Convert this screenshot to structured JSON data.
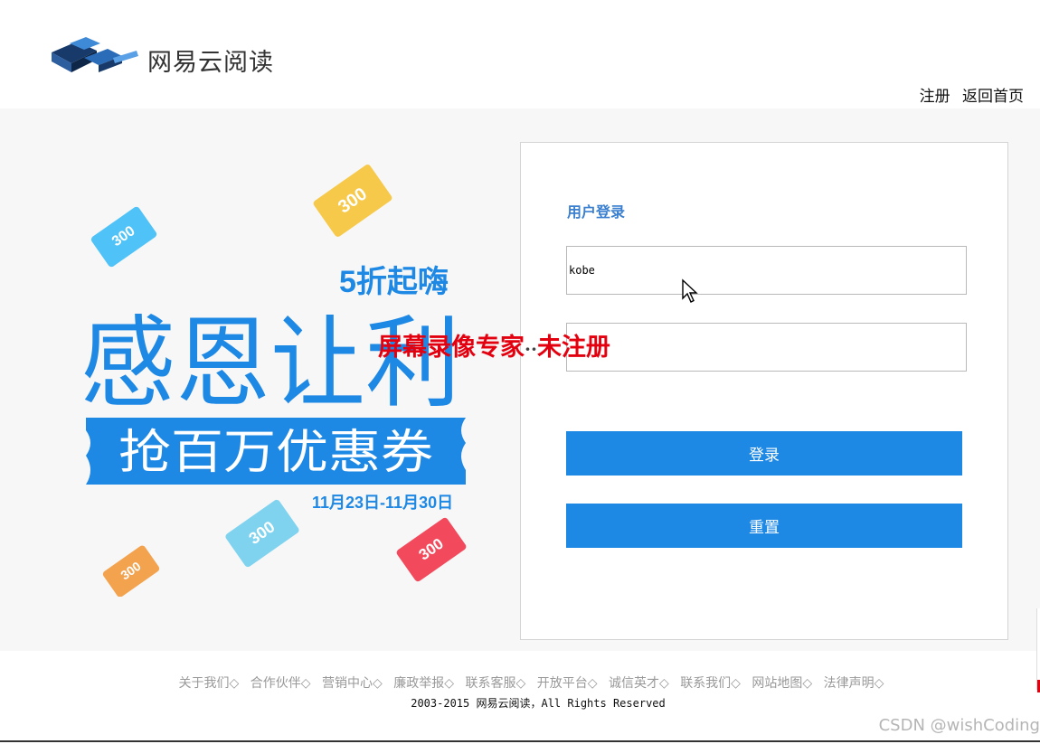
{
  "header": {
    "brand": "网易云阅读",
    "links": [
      "注册",
      "返回首页"
    ]
  },
  "banner": {
    "headline": "感恩让利",
    "subheadline": "5折起嗨",
    "ribbon": "抢百万优惠券",
    "date_range": "11月23日-11月30日",
    "coupon_value": "300",
    "coupon_label": "优惠券",
    "colors": {
      "blue": "#1e88e5",
      "cyan": "#4fc3f7",
      "yellow": "#f6c94a",
      "orange": "#f3a24e",
      "red": "#f24a5c",
      "sky": "#7fd3ef"
    }
  },
  "login": {
    "title": "用户登录",
    "username_value": "kobe",
    "password_value": "",
    "submit_label": "登录",
    "reset_label": "重置"
  },
  "watermark": {
    "left": "屏幕录像专家",
    "dots": "··",
    "right": "未注册"
  },
  "footer": {
    "links": [
      "关于我们◇",
      "合作伙伴◇",
      "营销中心◇",
      "廉政举报◇",
      "联系客服◇",
      "开放平台◇",
      "诚信英才◇",
      "联系我们◇",
      "网站地图◇",
      "法律声明◇"
    ],
    "copyright": "2003-2015 网易云阅读，All Rights Reserved",
    "credit": "CSDN @wishCoding"
  },
  "theme": {
    "accent": "#1e88e5",
    "title": "#3a7fd0",
    "watermark": "#e3000f"
  }
}
